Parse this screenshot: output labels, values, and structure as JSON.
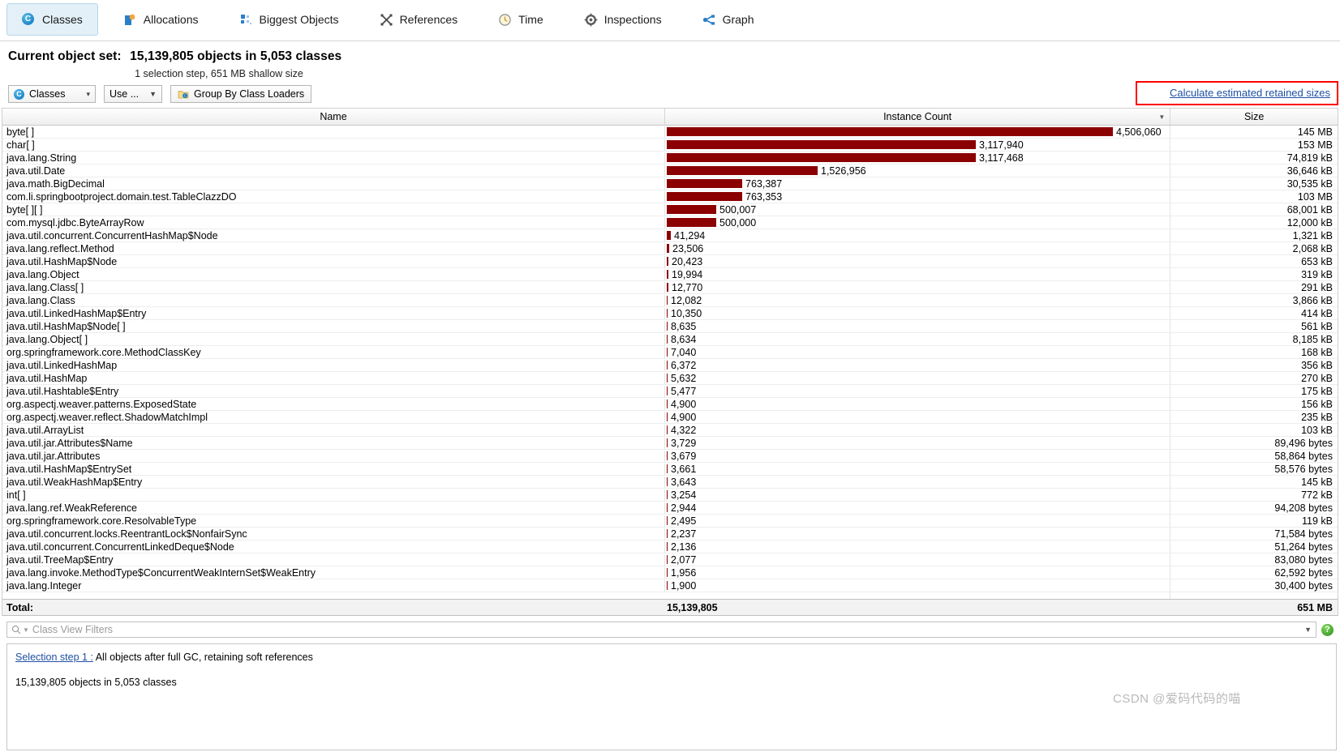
{
  "tabs": [
    {
      "label": "Classes",
      "icon": "classes-icon",
      "active": true
    },
    {
      "label": "Allocations",
      "icon": "allocations-icon",
      "active": false
    },
    {
      "label": "Biggest Objects",
      "icon": "biggest-objects-icon",
      "active": false
    },
    {
      "label": "References",
      "icon": "references-icon",
      "active": false
    },
    {
      "label": "Time",
      "icon": "time-icon",
      "active": false
    },
    {
      "label": "Inspections",
      "icon": "inspections-icon",
      "active": false
    },
    {
      "label": "Graph",
      "icon": "graph-icon",
      "active": false
    }
  ],
  "header": {
    "current_set_label": "Current object set:",
    "current_set_value": "15,139,805 objects in 5,053 classes",
    "sub_line": "1 selection step, 651 MB shallow size"
  },
  "toolbar": {
    "view_select": "Classes",
    "use_button": "Use ...",
    "group_button": "Group By Class Loaders",
    "retained_link": "Calculate estimated retained sizes"
  },
  "table": {
    "columns": {
      "name": "Name",
      "count": "Instance Count",
      "size": "Size"
    },
    "sort_column": "Instance Count",
    "sort_direction": "descending",
    "bar_color": "#8b0000",
    "max_count": 4506060,
    "rows": [
      {
        "name": "byte[ ]",
        "count": "4,506,060",
        "count_value": 4506060,
        "size": "145 MB"
      },
      {
        "name": "char[ ]",
        "count": "3,117,940",
        "count_value": 3117940,
        "size": "153 MB"
      },
      {
        "name": "java.lang.String",
        "count": "3,117,468",
        "count_value": 3117468,
        "size": "74,819 kB"
      },
      {
        "name": "java.util.Date",
        "count": "1,526,956",
        "count_value": 1526956,
        "size": "36,646 kB"
      },
      {
        "name": "java.math.BigDecimal",
        "count": "763,387",
        "count_value": 763387,
        "size": "30,535 kB"
      },
      {
        "name": "com.li.springbootproject.domain.test.TableClazzDO",
        "count": "763,353",
        "count_value": 763353,
        "size": "103 MB"
      },
      {
        "name": "byte[ ][ ]",
        "count": "500,007",
        "count_value": 500007,
        "size": "68,001 kB"
      },
      {
        "name": "com.mysql.jdbc.ByteArrayRow",
        "count": "500,000",
        "count_value": 500000,
        "size": "12,000 kB"
      },
      {
        "name": "java.util.concurrent.ConcurrentHashMap$Node",
        "count": "41,294",
        "count_value": 41294,
        "size": "1,321 kB"
      },
      {
        "name": "java.lang.reflect.Method",
        "count": "23,506",
        "count_value": 23506,
        "size": "2,068 kB"
      },
      {
        "name": "java.util.HashMap$Node",
        "count": "20,423",
        "count_value": 20423,
        "size": "653 kB"
      },
      {
        "name": "java.lang.Object",
        "count": "19,994",
        "count_value": 19994,
        "size": "319 kB"
      },
      {
        "name": "java.lang.Class[ ]",
        "count": "12,770",
        "count_value": 12770,
        "size": "291 kB"
      },
      {
        "name": "java.lang.Class",
        "count": "12,082",
        "count_value": 12082,
        "size": "3,866 kB"
      },
      {
        "name": "java.util.LinkedHashMap$Entry",
        "count": "10,350",
        "count_value": 10350,
        "size": "414 kB"
      },
      {
        "name": "java.util.HashMap$Node[ ]",
        "count": "8,635",
        "count_value": 8635,
        "size": "561 kB"
      },
      {
        "name": "java.lang.Object[ ]",
        "count": "8,634",
        "count_value": 8634,
        "size": "8,185 kB"
      },
      {
        "name": "org.springframework.core.MethodClassKey",
        "count": "7,040",
        "count_value": 7040,
        "size": "168 kB"
      },
      {
        "name": "java.util.LinkedHashMap",
        "count": "6,372",
        "count_value": 6372,
        "size": "356 kB"
      },
      {
        "name": "java.util.HashMap",
        "count": "5,632",
        "count_value": 5632,
        "size": "270 kB"
      },
      {
        "name": "java.util.Hashtable$Entry",
        "count": "5,477",
        "count_value": 5477,
        "size": "175 kB"
      },
      {
        "name": "org.aspectj.weaver.patterns.ExposedState",
        "count": "4,900",
        "count_value": 4900,
        "size": "156 kB"
      },
      {
        "name": "org.aspectj.weaver.reflect.ShadowMatchImpl",
        "count": "4,900",
        "count_value": 4900,
        "size": "235 kB"
      },
      {
        "name": "java.util.ArrayList",
        "count": "4,322",
        "count_value": 4322,
        "size": "103 kB"
      },
      {
        "name": "java.util.jar.Attributes$Name",
        "count": "3,729",
        "count_value": 3729,
        "size": "89,496 bytes"
      },
      {
        "name": "java.util.jar.Attributes",
        "count": "3,679",
        "count_value": 3679,
        "size": "58,864 bytes"
      },
      {
        "name": "java.util.HashMap$EntrySet",
        "count": "3,661",
        "count_value": 3661,
        "size": "58,576 bytes"
      },
      {
        "name": "java.util.WeakHashMap$Entry",
        "count": "3,643",
        "count_value": 3643,
        "size": "145 kB"
      },
      {
        "name": "int[ ]",
        "count": "3,254",
        "count_value": 3254,
        "size": "772 kB"
      },
      {
        "name": "java.lang.ref.WeakReference",
        "count": "2,944",
        "count_value": 2944,
        "size": "94,208 bytes"
      },
      {
        "name": "org.springframework.core.ResolvableType",
        "count": "2,495",
        "count_value": 2495,
        "size": "119 kB"
      },
      {
        "name": "java.util.concurrent.locks.ReentrantLock$NonfairSync",
        "count": "2,237",
        "count_value": 2237,
        "size": "71,584 bytes"
      },
      {
        "name": "java.util.concurrent.ConcurrentLinkedDeque$Node",
        "count": "2,136",
        "count_value": 2136,
        "size": "51,264 bytes"
      },
      {
        "name": "java.util.TreeMap$Entry",
        "count": "2,077",
        "count_value": 2077,
        "size": "83,080 bytes"
      },
      {
        "name": "java.lang.invoke.MethodType$ConcurrentWeakInternSet$WeakEntry",
        "count": "1,956",
        "count_value": 1956,
        "size": "62,592 bytes"
      },
      {
        "name": "java.lang.Integer",
        "count": "1,900",
        "count_value": 1900,
        "size": "30,400 bytes"
      }
    ],
    "total": {
      "label": "Total:",
      "count": "15,139,805",
      "size": "651 MB"
    }
  },
  "filter": {
    "placeholder": "Class View Filters",
    "help_label": "?"
  },
  "bottom": {
    "step_link": "Selection step 1 :",
    "step_text": "All objects after full GC, retaining soft references",
    "step_count": "15,139,805 objects in 5,053 classes"
  },
  "watermark": "CSDN @爱码代码的喵",
  "colors": {
    "bar": "#8b0000",
    "link": "#1f4fa5",
    "annotation": "#ff0000",
    "active_tab_bg": "#e3f0f8"
  }
}
